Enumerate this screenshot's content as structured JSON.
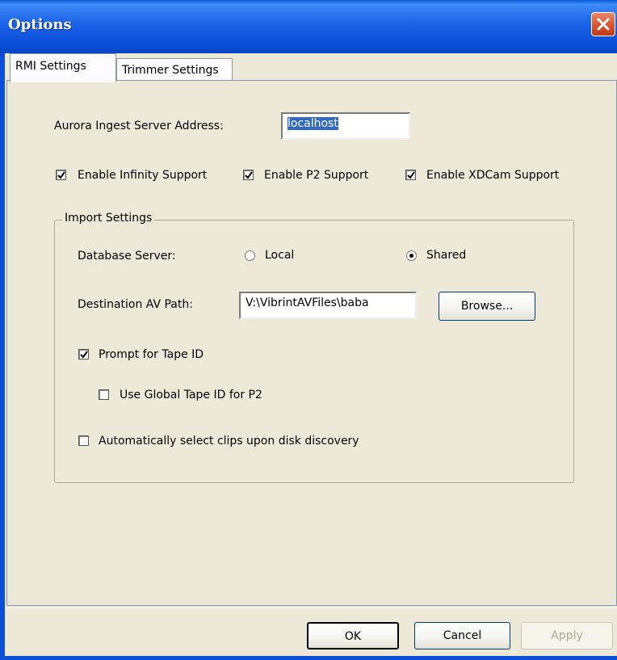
{
  "window": {
    "title": "Options"
  },
  "tabs": [
    {
      "label": "RMI Settings",
      "active": true
    },
    {
      "label": "Trimmer Settings",
      "active": false
    }
  ],
  "server": {
    "label": "Aurora Ingest Server Address:",
    "value": "localhost"
  },
  "support": {
    "infinity": {
      "label": "Enable Infinity Support",
      "checked": true
    },
    "p2": {
      "label": "Enable P2 Support",
      "checked": true
    },
    "xdcam": {
      "label": "Enable XDCam Support",
      "checked": true
    }
  },
  "import_settings": {
    "title": "Import Settings",
    "database_server": {
      "label": "Database Server:",
      "options": [
        {
          "label": "Local",
          "selected": false
        },
        {
          "label": "Shared",
          "selected": true
        }
      ]
    },
    "destination": {
      "label": "Destination AV Path:",
      "value": "V:\\VibrintAVFiles\\baba",
      "browse_label": "Browse..."
    },
    "prompt_tape_id": {
      "label": "Prompt for Tape ID",
      "checked": true
    },
    "global_tape_id": {
      "label": "Use Global Tape ID for P2",
      "checked": false
    },
    "auto_select": {
      "label": "Automatically select clips upon disk discovery",
      "checked": false
    }
  },
  "buttons": {
    "ok": "OK",
    "cancel": "Cancel",
    "apply": "Apply"
  },
  "colors": {
    "titlebar": "#0B4FD9",
    "selection": "#316AC5",
    "dialog_bg": "#ECE9D8"
  }
}
